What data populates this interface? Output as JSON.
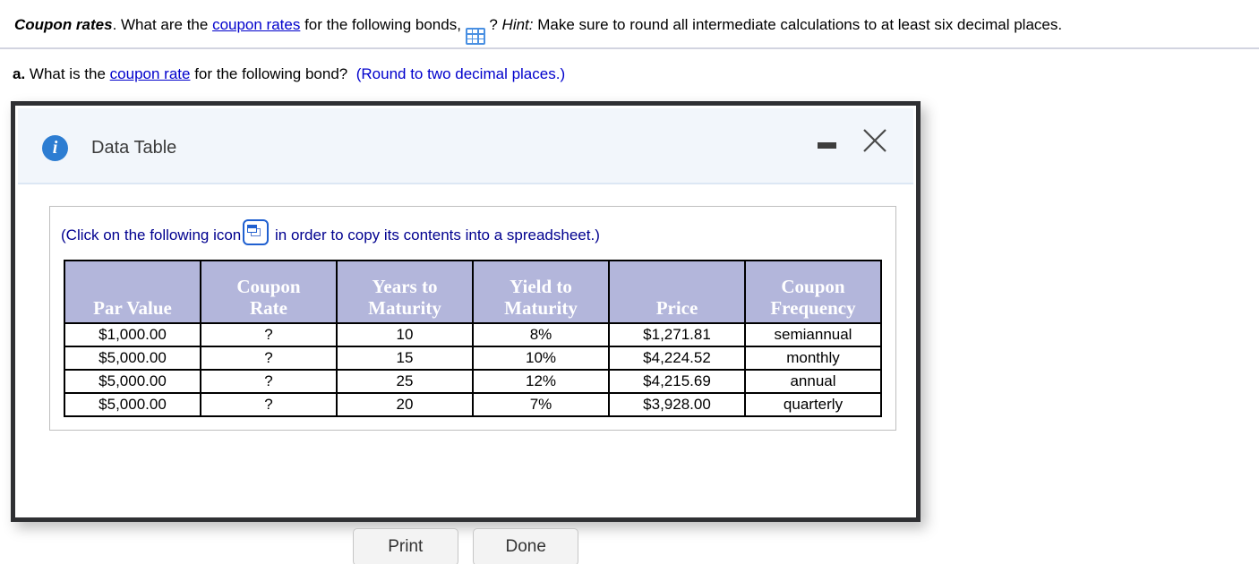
{
  "question": {
    "line1": {
      "lead": "Coupon rates",
      "text_a": ". What are the ",
      "link": "coupon rates",
      "text_b": " for the following bonds, ",
      "grid_icon": "spreadsheet-grid-icon",
      "text_c": " ? ",
      "hint_label": "Hint:",
      "hint_text": " Make sure to round all intermediate calculations to at least six decimal places."
    },
    "line2": {
      "part": "a.",
      "text_a": " What is the ",
      "link": "coupon rate",
      "text_b": " for the following bond?",
      "round_note": "(Round to two decimal places.)"
    }
  },
  "dialog": {
    "info_icon": "info-icon",
    "title": "Data Table",
    "minimize_label": "minimize",
    "close_label": "close",
    "copy_hint": {
      "text_a": "(Click on the following icon",
      "icon": "copy-to-spreadsheet-icon",
      "text_b": " in order to copy its contents into a spreadsheet.)"
    },
    "table": {
      "headers": [
        "Par Value",
        "Coupon Rate",
        "Years to Maturity",
        "Yield to Maturity",
        "Price",
        "Coupon Frequency"
      ],
      "headers_lines": [
        [
          "",
          "Par Value"
        ],
        [
          "Coupon",
          "Rate"
        ],
        [
          "Years to",
          "Maturity"
        ],
        [
          "Yield to",
          "Maturity"
        ],
        [
          "",
          "Price"
        ],
        [
          "Coupon",
          "Frequency"
        ]
      ],
      "rows": [
        [
          "$1,000.00",
          "?",
          "10",
          "8%",
          "$1,271.81",
          "semiannual"
        ],
        [
          "$5,000.00",
          "?",
          "15",
          "10%",
          "$4,224.52",
          "monthly"
        ],
        [
          "$5,000.00",
          "?",
          "25",
          "12%",
          "$4,215.69",
          "annual"
        ],
        [
          "$5,000.00",
          "?",
          "20",
          "7%",
          "$3,928.00",
          "quarterly"
        ]
      ]
    },
    "buttons": {
      "print": "Print",
      "done": "Done"
    }
  },
  "colors": {
    "link": "#0000cc",
    "table_header_bg": "#b3b6db",
    "dialog_border": "#2f3033",
    "title_bar_bg": "#f2f6fb",
    "info_icon_bg": "#2d7dd2",
    "hint_text": "#00008f"
  }
}
